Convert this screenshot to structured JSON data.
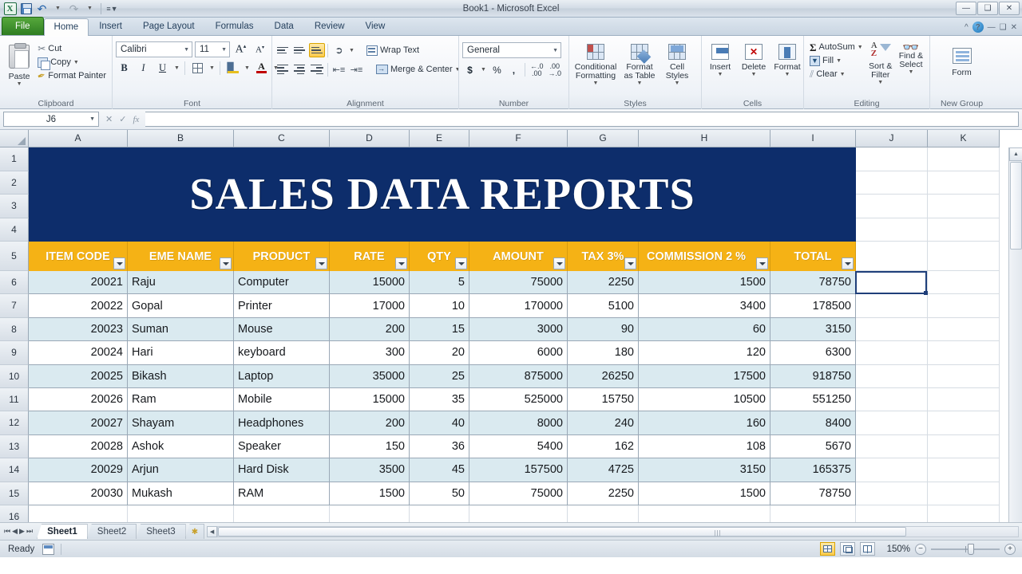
{
  "window": {
    "title": "Book1  -  Microsoft Excel",
    "qat": [
      "save-icon",
      "undo-icon",
      "redo-icon",
      "customize-icon"
    ],
    "buttons": [
      "minimize",
      "restore",
      "close"
    ]
  },
  "ribbon": {
    "tabs": [
      "File",
      "Home",
      "Insert",
      "Page Layout",
      "Formulas",
      "Data",
      "Review",
      "View"
    ],
    "active_tab": "Home",
    "groups": {
      "clipboard": {
        "label": "Clipboard",
        "paste": "Paste",
        "cut": "Cut",
        "copy": "Copy",
        "format_painter": "Format Painter"
      },
      "font": {
        "label": "Font",
        "font_name": "Calibri",
        "font_size": "11",
        "bold": "B",
        "italic": "I",
        "underline": "U"
      },
      "alignment": {
        "label": "Alignment",
        "wrap_text": "Wrap Text",
        "merge_center": "Merge & Center"
      },
      "number": {
        "label": "Number",
        "format": "General",
        "currency": "$",
        "percent": "%",
        "comma": ",",
        "inc_dec": ".00",
        "dec_dec": ".00"
      },
      "styles": {
        "label": "Styles",
        "conditional_formatting": "Conditional Formatting",
        "format_as_table": "Format as Table",
        "cell_styles": "Cell Styles"
      },
      "cells": {
        "label": "Cells",
        "insert": "Insert",
        "delete": "Delete",
        "format": "Format"
      },
      "editing": {
        "label": "Editing",
        "autosum": "AutoSum",
        "fill": "Fill",
        "clear": "Clear",
        "sort_filter": "Sort & Filter",
        "find_select": "Find & Select"
      },
      "new_group": {
        "label": "New Group",
        "form": "Form"
      }
    }
  },
  "formula_bar": {
    "name_box": "J6",
    "formula": ""
  },
  "grid": {
    "column_headers": [
      "A",
      "B",
      "C",
      "D",
      "E",
      "F",
      "G",
      "H",
      "I",
      "J",
      "K"
    ],
    "row_headers": [
      "1",
      "2",
      "3",
      "4",
      "5",
      "6",
      "7",
      "8",
      "9",
      "10",
      "11",
      "12",
      "13",
      "14",
      "15",
      "16"
    ],
    "selected_cell": "J6",
    "banner_title": "SALES DATA REPORTS",
    "banner_color": "#0d2d6b",
    "header_color": "#f5b215",
    "band_color": "#daeaf0"
  },
  "table": {
    "headers": [
      "ITEM CODE",
      "EME NAME",
      "PRODUCT",
      "RATE",
      "QTY",
      "AMOUNT",
      "TAX 3%",
      "COMMISSION 2 %",
      "TOTAL"
    ],
    "rows": [
      [
        "20021",
        "Raju",
        "Computer",
        "15000",
        "5",
        "75000",
        "2250",
        "1500",
        "78750"
      ],
      [
        "20022",
        "Gopal",
        "Printer",
        "17000",
        "10",
        "170000",
        "5100",
        "3400",
        "178500"
      ],
      [
        "20023",
        "Suman",
        "Mouse",
        "200",
        "15",
        "3000",
        "90",
        "60",
        "3150"
      ],
      [
        "20024",
        "Hari",
        "keyboard",
        "300",
        "20",
        "6000",
        "180",
        "120",
        "6300"
      ],
      [
        "20025",
        "Bikash",
        "Laptop",
        "35000",
        "25",
        "875000",
        "26250",
        "17500",
        "918750"
      ],
      [
        "20026",
        "Ram",
        "Mobile",
        "15000",
        "35",
        "525000",
        "15750",
        "10500",
        "551250"
      ],
      [
        "20027",
        "Shayam",
        "Headphones",
        "200",
        "40",
        "8000",
        "240",
        "160",
        "8400"
      ],
      [
        "20028",
        "Ashok",
        "Speaker",
        "150",
        "36",
        "5400",
        "162",
        "108",
        "5670"
      ],
      [
        "20029",
        "Arjun",
        "Hard Disk",
        "3500",
        "45",
        "157500",
        "4725",
        "3150",
        "165375"
      ],
      [
        "20030",
        "Mukash",
        "RAM",
        "1500",
        "50",
        "75000",
        "2250",
        "1500",
        "78750"
      ]
    ]
  },
  "sheet_tabs": {
    "tabs": [
      "Sheet1",
      "Sheet2",
      "Sheet3"
    ],
    "active": "Sheet1"
  },
  "status_bar": {
    "state": "Ready",
    "zoom": "150%",
    "views": [
      "normal-view",
      "page-layout-view",
      "page-break-view"
    ]
  }
}
